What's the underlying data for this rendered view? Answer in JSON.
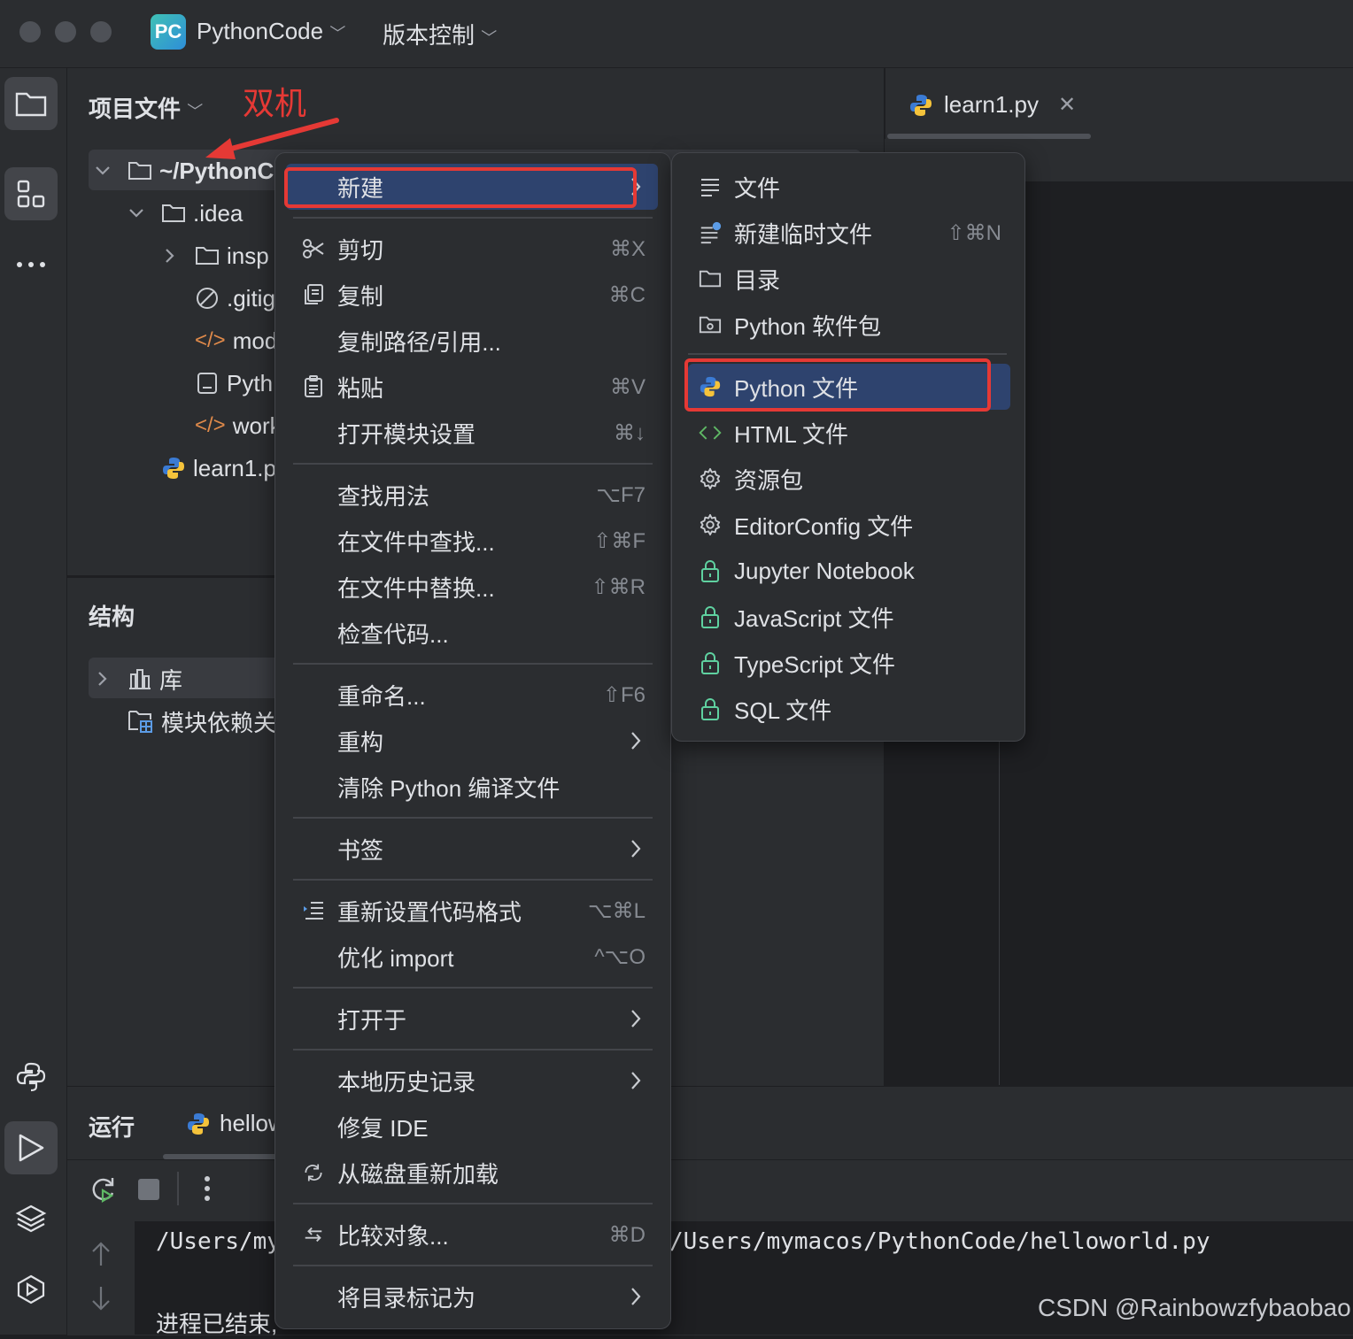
{
  "colors": {
    "accent": "#2e436e",
    "highlight_border": "#e53935",
    "annotation": "#e53935"
  },
  "titlebar": {
    "app_badge": "PC",
    "project_name": "PythonCode",
    "vcs_menu": "版本控制"
  },
  "annotation": {
    "text": "双机"
  },
  "project_panel": {
    "title": "项目文件",
    "tree": [
      {
        "label": "~/PythonC",
        "icon": "folder-icon"
      },
      {
        "label": ".idea",
        "icon": "folder-icon"
      },
      {
        "label": "insp",
        "icon": "folder-icon"
      },
      {
        "label": ".gitig",
        "icon": "ignore-icon"
      },
      {
        "label": "mod",
        "icon": "xml-icon"
      },
      {
        "label": "Pyth",
        "icon": "file-icon"
      },
      {
        "label": "work",
        "icon": "xml-icon"
      },
      {
        "label": "learn1.p",
        "icon": "python-icon"
      }
    ]
  },
  "structure_panel": {
    "title": "结构",
    "items": [
      {
        "label": "库",
        "icon": "library-icon"
      },
      {
        "label": "模块依赖关",
        "icon": "module-deps-icon"
      }
    ]
  },
  "editor": {
    "tab_label": "learn1.py"
  },
  "run_panel": {
    "title": "运行",
    "tab_label": "hellow",
    "console_lines": [
      "/Users/my",
      "/Users/mymacos/PythonCode/helloworld.py",
      "进程已结束,"
    ]
  },
  "context_menu": {
    "items": [
      {
        "label": "新建",
        "shortcut": "",
        "submenu": true,
        "icon": ""
      },
      {
        "label": "剪切",
        "shortcut": "⌘X",
        "submenu": false,
        "icon": "scissors-icon"
      },
      {
        "label": "复制",
        "shortcut": "⌘C",
        "submenu": false,
        "icon": "copy-icon"
      },
      {
        "label": "复制路径/引用...",
        "shortcut": "",
        "submenu": false,
        "icon": ""
      },
      {
        "label": "粘贴",
        "shortcut": "⌘V",
        "submenu": false,
        "icon": "paste-icon"
      },
      {
        "label": "打开模块设置",
        "shortcut": "⌘↓",
        "submenu": false,
        "icon": ""
      },
      {
        "label": "查找用法",
        "shortcut": "⌥F7",
        "submenu": false,
        "icon": ""
      },
      {
        "label": "在文件中查找...",
        "shortcut": "⇧⌘F",
        "submenu": false,
        "icon": ""
      },
      {
        "label": "在文件中替换...",
        "shortcut": "⇧⌘R",
        "submenu": false,
        "icon": ""
      },
      {
        "label": "检查代码...",
        "shortcut": "",
        "submenu": false,
        "icon": ""
      },
      {
        "label": "重命名...",
        "shortcut": "⇧F6",
        "submenu": false,
        "icon": ""
      },
      {
        "label": "重构",
        "shortcut": "",
        "submenu": true,
        "icon": ""
      },
      {
        "label": "清除 Python 编译文件",
        "shortcut": "",
        "submenu": false,
        "icon": ""
      },
      {
        "label": "书签",
        "shortcut": "",
        "submenu": true,
        "icon": ""
      },
      {
        "label": "重新设置代码格式",
        "shortcut": "⌥⌘L",
        "submenu": false,
        "icon": "format-icon"
      },
      {
        "label": "优化 import",
        "shortcut": "^⌥O",
        "submenu": false,
        "icon": ""
      },
      {
        "label": "打开于",
        "shortcut": "",
        "submenu": true,
        "icon": ""
      },
      {
        "label": "本地历史记录",
        "shortcut": "",
        "submenu": true,
        "icon": ""
      },
      {
        "label": "修复 IDE",
        "shortcut": "",
        "submenu": false,
        "icon": ""
      },
      {
        "label": "从磁盘重新加载",
        "shortcut": "",
        "submenu": false,
        "icon": "reload-icon"
      },
      {
        "label": "比较对象...",
        "shortcut": "⌘D",
        "submenu": false,
        "icon": "compare-icon"
      },
      {
        "label": "将目录标记为",
        "shortcut": "",
        "submenu": true,
        "icon": ""
      }
    ]
  },
  "new_submenu": {
    "items": [
      {
        "label": "文件",
        "shortcut": "",
        "icon": "text-file-icon"
      },
      {
        "label": "新建临时文件",
        "shortcut": "⇧⌘N",
        "icon": "scratch-file-icon"
      },
      {
        "label": "目录",
        "shortcut": "",
        "icon": "folder-icon"
      },
      {
        "label": "Python 软件包",
        "shortcut": "",
        "icon": "package-icon"
      },
      {
        "label": "Python 文件",
        "shortcut": "",
        "icon": "python-icon"
      },
      {
        "label": "HTML 文件",
        "shortcut": "",
        "icon": "html-icon"
      },
      {
        "label": "资源包",
        "shortcut": "",
        "icon": "gear-icon"
      },
      {
        "label": "EditorConfig 文件",
        "shortcut": "",
        "icon": "gear-icon"
      },
      {
        "label": "Jupyter Notebook",
        "shortcut": "",
        "icon": "lock-icon"
      },
      {
        "label": "JavaScript 文件",
        "shortcut": "",
        "icon": "lock-icon"
      },
      {
        "label": "TypeScript 文件",
        "shortcut": "",
        "icon": "lock-icon"
      },
      {
        "label": "SQL 文件",
        "shortcut": "",
        "icon": "lock-icon"
      }
    ]
  },
  "watermark": "CSDN @Rainbowzfybaobao"
}
